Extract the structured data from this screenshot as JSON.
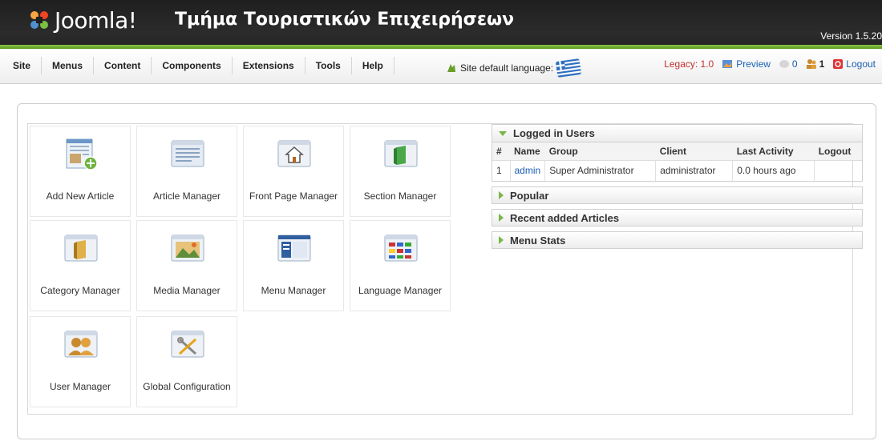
{
  "header": {
    "logo_text": "Joomla!",
    "site_title": "Τμήμα Τουριστικών Επιχειρήσεων",
    "version": "Version 1.5.20"
  },
  "menu": {
    "items": [
      "Site",
      "Menus",
      "Content",
      "Components",
      "Extensions",
      "Tools",
      "Help"
    ]
  },
  "site_language": {
    "label": "Site default language:",
    "flag_icon": "greek-flag-icon"
  },
  "status": {
    "legacy": "Legacy: 1.0",
    "preview": "Preview",
    "messages_count": "0",
    "users_count": "1",
    "logout": "Logout"
  },
  "tiles": [
    {
      "label": "Add New Article",
      "icon": "add-article-icon"
    },
    {
      "label": "Article Manager",
      "icon": "article-manager-icon"
    },
    {
      "label": "Front Page Manager",
      "icon": "front-page-icon"
    },
    {
      "label": "Section Manager",
      "icon": "section-manager-icon"
    },
    {
      "label": "Category Manager",
      "icon": "category-manager-icon"
    },
    {
      "label": "Media Manager",
      "icon": "media-manager-icon"
    },
    {
      "label": "Menu Manager",
      "icon": "menu-manager-icon"
    },
    {
      "label": "Language Manager",
      "icon": "language-manager-icon"
    },
    {
      "label": "User Manager",
      "icon": "user-manager-icon"
    },
    {
      "label": "Global Configuration",
      "icon": "global-config-icon"
    }
  ],
  "modules": {
    "logged_in": {
      "title": "Logged in Users",
      "columns": [
        "#",
        "Name",
        "Group",
        "Client",
        "Last Activity",
        "Logout"
      ],
      "rows": [
        {
          "num": "1",
          "name": "admin",
          "group": "Super Administrator",
          "client": "administrator",
          "activity": "0.0 hours ago",
          "logout": ""
        }
      ]
    },
    "popular": "Popular",
    "recent": "Recent added Articles",
    "menu_stats": "Menu Stats"
  },
  "colors": {
    "accent_green": "#7ab648",
    "link_blue": "#1a5fb4",
    "legacy_red": "#c23030",
    "header_dark": "#222222"
  }
}
